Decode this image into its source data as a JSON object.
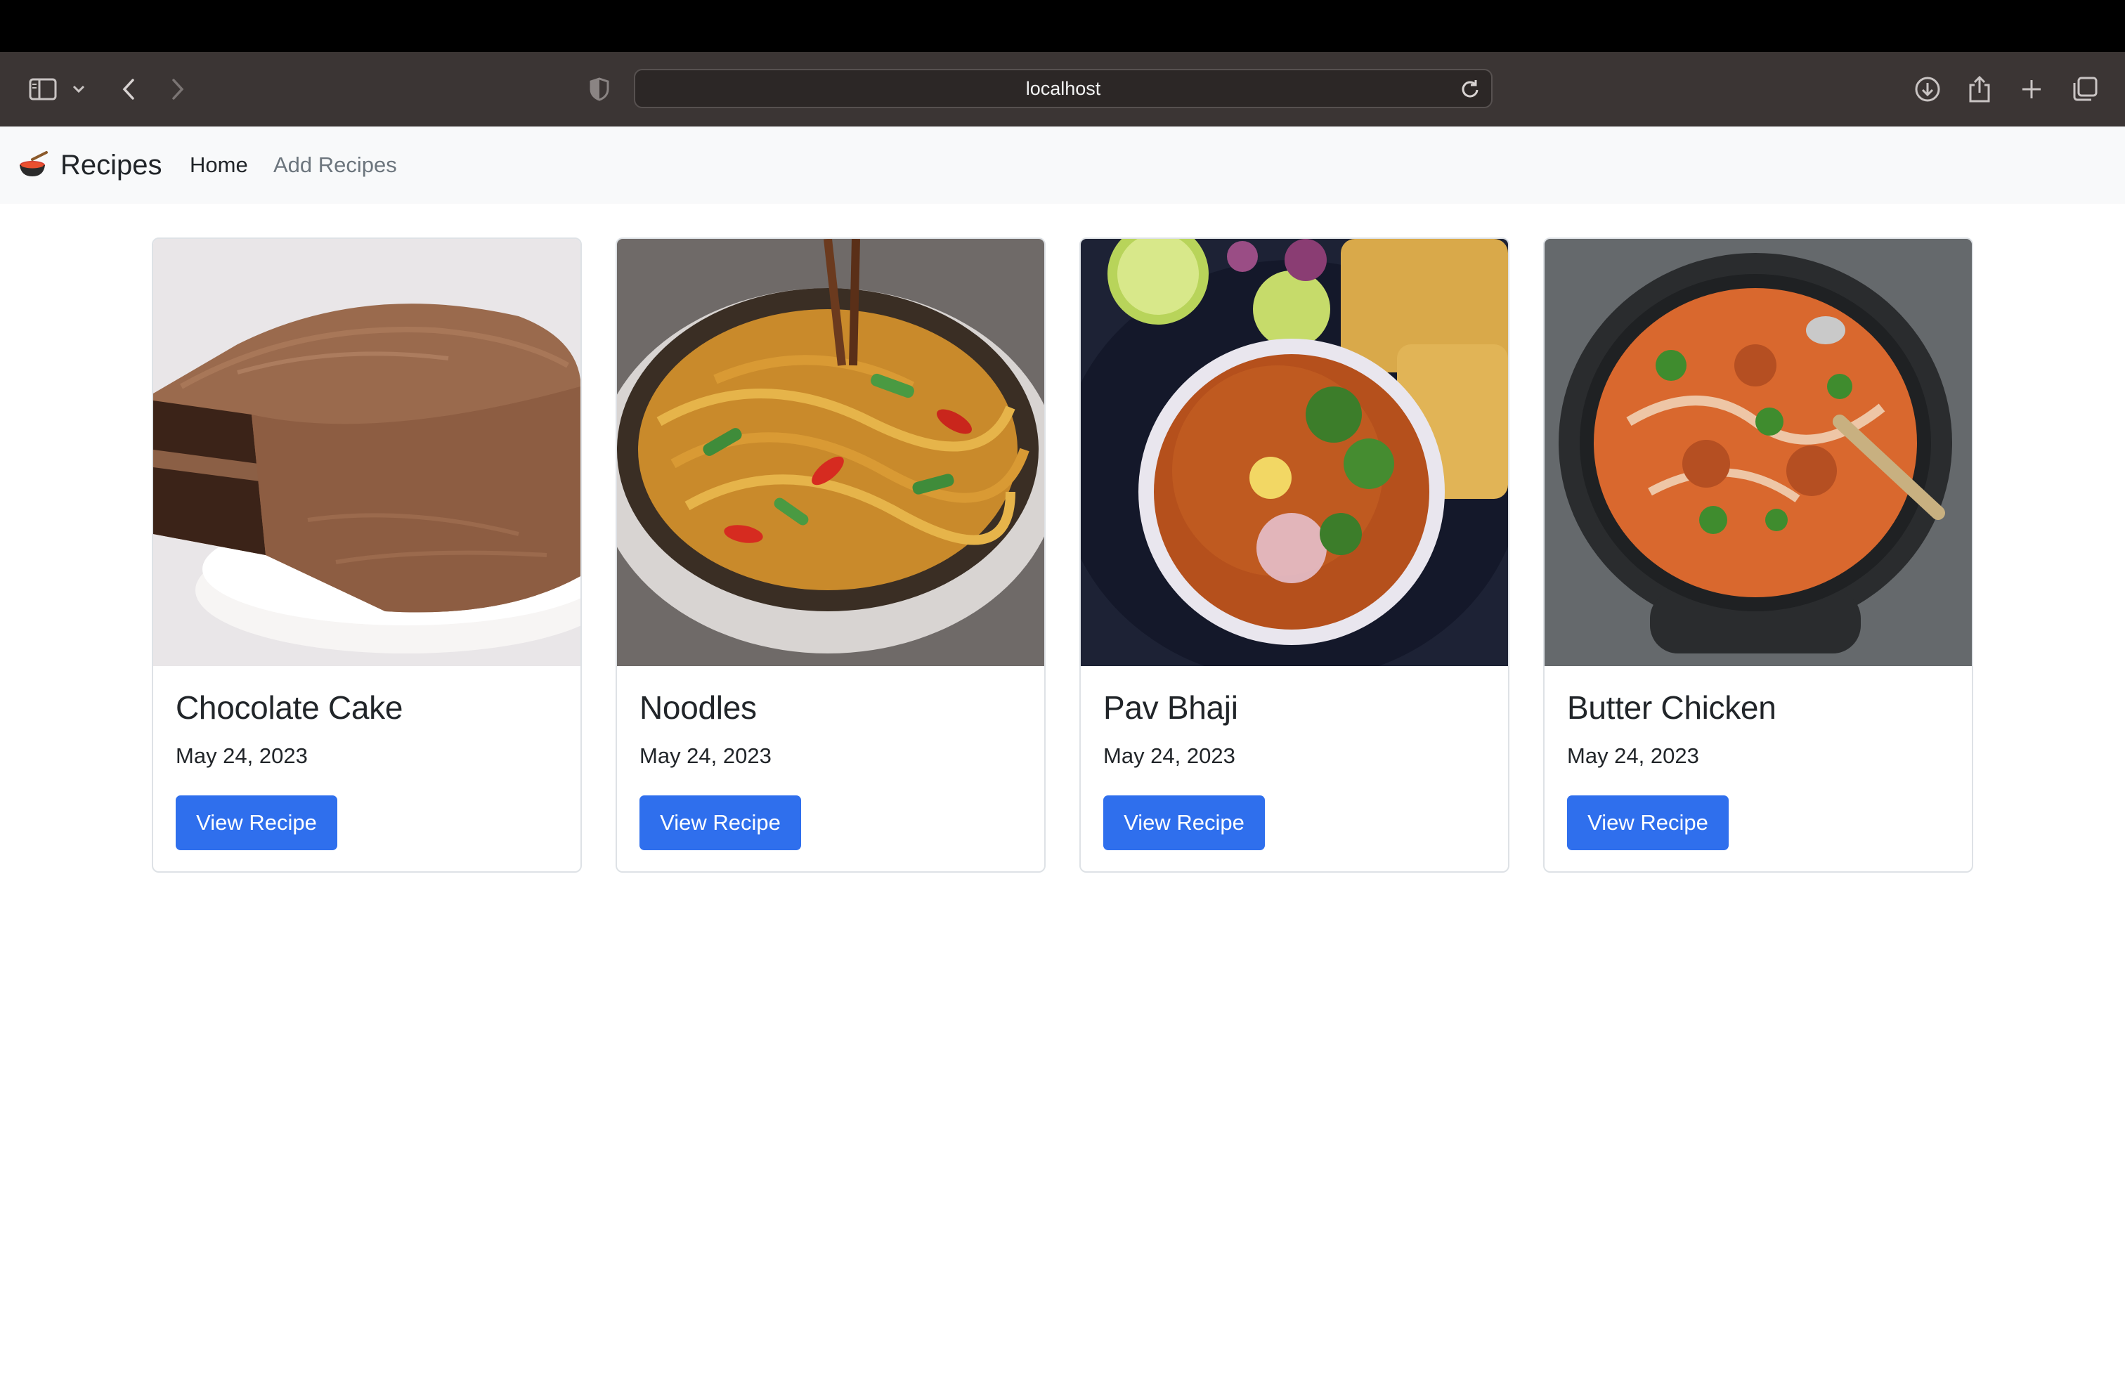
{
  "browser": {
    "address": "localhost",
    "icons": [
      "sidebar-icon",
      "chevron-down-icon",
      "back-icon",
      "forward-icon",
      "shield-icon",
      "reload-icon",
      "download-icon",
      "share-icon",
      "new-tab-icon",
      "tab-overview-icon"
    ]
  },
  "navbar": {
    "brand": "Recipes",
    "brand_icon": "cooking-pot-icon",
    "links": [
      "Home",
      "Add Recipes"
    ]
  },
  "cards": [
    {
      "title": "Chocolate Cake",
      "date": "May 24, 2023",
      "button": "View Recipe",
      "image": "chocolate-cake-photo"
    },
    {
      "title": "Noodles",
      "date": "May 24, 2023",
      "button": "View Recipe",
      "image": "noodles-photo"
    },
    {
      "title": "Pav Bhaji",
      "date": "May 24, 2023",
      "button": "View Recipe",
      "image": "pav-bhaji-photo"
    },
    {
      "title": "Butter Chicken",
      "date": "May 24, 2023",
      "button": "View Recipe",
      "image": "butter-chicken-photo"
    }
  ],
  "colors": {
    "primary": "#2f6fed",
    "navbar_bg": "#f8f9fa",
    "toolbar_bg": "#3b3534"
  }
}
